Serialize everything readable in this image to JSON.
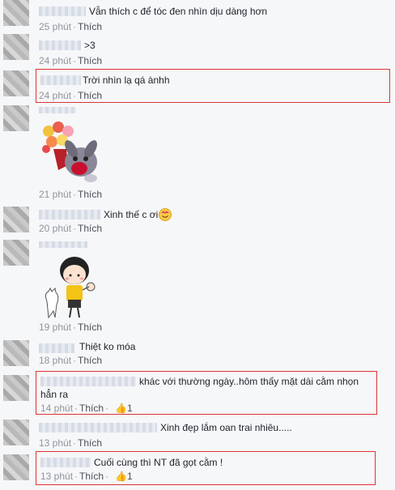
{
  "comments": [
    {
      "text": "Vẫn thích c để tóc đen nhìn dịu dàng hơn",
      "time": "25 phút",
      "like_label": "Thích"
    },
    {
      "text": ">3",
      "time": "24 phút",
      "like_label": "Thích"
    },
    {
      "text": "Trời nhìn lạ qá ànhh",
      "time": "24 phút",
      "like_label": "Thích"
    },
    {
      "text": "",
      "time": "21 phút",
      "like_label": "Thích"
    },
    {
      "text": "Xinh thế c ơi",
      "time": "20 phút",
      "like_label": "Thích"
    },
    {
      "text": "",
      "time": "19 phút",
      "like_label": "Thích"
    },
    {
      "text": "Thiệt ko móa",
      "time": "18 phút",
      "like_label": "Thích"
    },
    {
      "text": "khác với thường ngày..hôm thấy mặt dài cằm nhọn",
      "text2": "hẳn ra",
      "time": "14 phút",
      "like_label": "Thích",
      "likes": "1"
    },
    {
      "text": "Xinh đẹp lắm oan trai nhiêu.....",
      "time": "13 phút",
      "like_label": "Thích"
    },
    {
      "text": "Cuối cùng thì NT đã gọt cằm !",
      "time": "13 phút",
      "like_label": "Thích",
      "likes": "1"
    }
  ],
  "colors": {
    "highlight": "#dd3333",
    "meta": "#90949c",
    "link": "#4267b2"
  }
}
